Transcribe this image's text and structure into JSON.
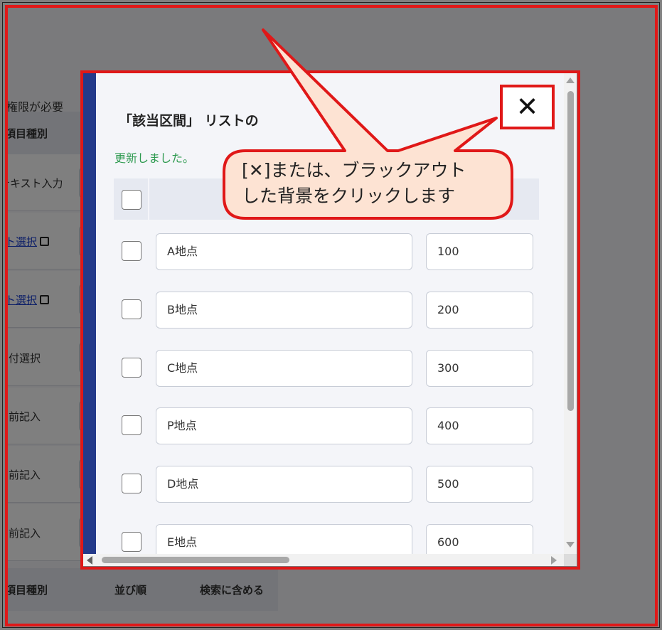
{
  "background": {
    "permission_note": "の権限が必要",
    "header_top": {
      "col1": "項目種別"
    },
    "header_bottom": {
      "col1": "項目種別",
      "col2": "並び順",
      "col3": "検索に含める"
    },
    "rows": [
      {
        "type_label": "テキスト入力",
        "is_link": false
      },
      {
        "type_label": "リスト選択",
        "is_link": true
      },
      {
        "type_label": "リスト選択",
        "is_link": true
      },
      {
        "type_label": "日付選択",
        "is_link": false
      },
      {
        "type_label": "名前記入",
        "is_link": false
      },
      {
        "type_label": "名前記入",
        "is_link": false
      },
      {
        "type_label": "名前記入",
        "is_link": false
      }
    ]
  },
  "modal": {
    "title": "「該当区間」 リストの",
    "update_message": "更新しました。",
    "close_label": "✕",
    "items": [
      {
        "name": "A地点",
        "value": "100"
      },
      {
        "name": "B地点",
        "value": "200"
      },
      {
        "name": "C地点",
        "value": "300"
      },
      {
        "name": "P地点",
        "value": "400"
      },
      {
        "name": "D地点",
        "value": "500"
      },
      {
        "name": "E地点",
        "value": "600"
      }
    ]
  },
  "callout": {
    "line1": "[✕]または、ブラックアウト",
    "line2": "した背景をクリックします"
  },
  "colors": {
    "accent": "#243a8a",
    "highlight": "#e01818",
    "callout_fill": "#fde3d3",
    "success": "#2e9a50",
    "link": "#1a3fd0"
  }
}
